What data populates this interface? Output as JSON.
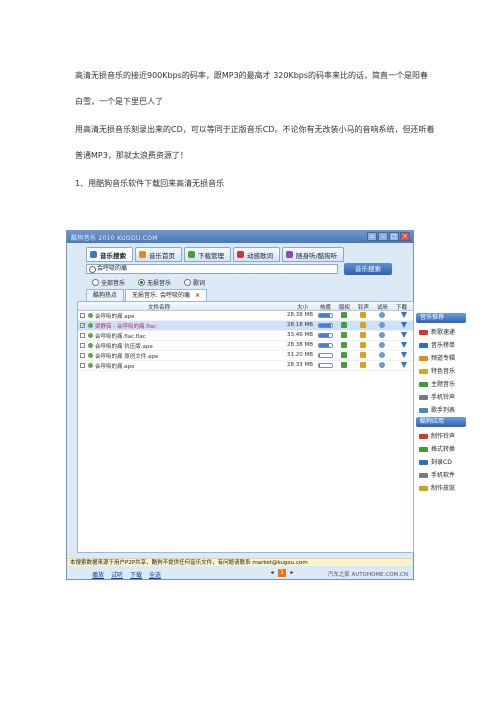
{
  "article": {
    "p1": "高清无损音乐的接近900Kbps的码率，跟MP3的最高才 320Kbps的码率来比的话，简直一个是阳春白雪，一个是下里巴人了",
    "p2": "用高清无损音乐刻录出来的CD，可以等同于正版音乐CD。不论你有无改装小马的音响系统，但还听着普通MP3，那就太浪费资源了！",
    "p3": "1、用酷狗音乐软件下载回来高清无损音乐"
  },
  "app": {
    "window_title": "酷狗音乐 2010 KUGOU.COM",
    "window_buttons": [
      "▫",
      "–",
      "□",
      "×"
    ],
    "tabs": [
      {
        "label": "音乐搜索",
        "icon": "search-icon",
        "color": "#3a77c9"
      },
      {
        "label": "音乐首页",
        "icon": "home-icon",
        "color": "#d98b22"
      },
      {
        "label": "下载管理",
        "icon": "download-icon",
        "color": "#4a9e3a"
      },
      {
        "label": "动感歌词",
        "icon": "lyrics-icon",
        "color": "#c7393a"
      },
      {
        "label": "随身听/酷狗听",
        "icon": "player-icon",
        "color": "#8a4bb5"
      }
    ],
    "search": {
      "value": "会呼吸的痛",
      "button": "音乐搜索"
    },
    "search_scope": [
      {
        "label": "全部音乐",
        "selected": false
      },
      {
        "label": "无损音乐",
        "selected": true
      },
      {
        "label": "歌词",
        "selected": false
      }
    ],
    "result_tabs": [
      {
        "label": "酷狗热点"
      },
      {
        "label": "无损音乐: 会呼吸的痛",
        "close": "×"
      }
    ],
    "table_headers": {
      "name": "文件名称",
      "size": "大小",
      "heat": "热度",
      "copyright": "版权",
      "ring": "铃声",
      "listen": "试听",
      "download": "下载"
    },
    "rows": [
      {
        "name": "会呼吸的痛.ape",
        "size": "28.38 MB",
        "heat": 0.85,
        "checked": false,
        "highlight": false
      },
      {
        "name": "梁静茹 - 会呼吸的痛.flac",
        "size": "28.18 MB",
        "heat": 0.9,
        "checked": true,
        "highlight": true
      },
      {
        "name": "会呼吸的痛.flac.flac",
        "size": "33.46 MB",
        "heat": 0.75,
        "checked": false,
        "highlight": false
      },
      {
        "name": "会呼吸的痛 抗压版.ape",
        "size": "28.38 MB",
        "heat": 0.8,
        "checked": false,
        "highlight": false
      },
      {
        "name": "会呼吸的痛 原创文件.ape",
        "size": "31.20 MB",
        "heat": 0.1,
        "checked": false,
        "highlight": false
      },
      {
        "name": "会呼吸的痛.ape",
        "size": "28.33 MB",
        "heat": 0.1,
        "checked": false,
        "highlight": false
      }
    ],
    "right_panel": {
      "section1": "音乐推荐",
      "items1": [
        {
          "label": "新歌速递",
          "color": "#d23a2a"
        },
        {
          "label": "音乐榜单",
          "color": "#2f6bc4"
        },
        {
          "label": "频道专辑",
          "color": "#e48a1d"
        },
        {
          "label": "特色音乐",
          "color": "#d6a81c"
        },
        {
          "label": "主题音乐",
          "color": "#3a9c3a"
        },
        {
          "label": "手机铃声",
          "color": "#7a7a7a"
        },
        {
          "label": "歌手列表",
          "color": "#4a86c9"
        }
      ],
      "section2": "酷狗应用",
      "items2": [
        {
          "label": "制作铃声",
          "color": "#d23a2a"
        },
        {
          "label": "格式转换",
          "color": "#3a9c3a"
        },
        {
          "label": "刻录CD",
          "color": "#2f6bc4"
        },
        {
          "label": "手机软件",
          "color": "#7a7a7a"
        },
        {
          "label": "制作皮肤",
          "color": "#c7a41c"
        }
      ]
    },
    "status": "本搜索数据来源于用户P2P共享，酷狗不提供任何音乐文件，有问题请联系 market@kugou.com",
    "bottom_links": [
      "播放",
      "试听",
      "下载",
      "全选"
    ],
    "pager": {
      "prev": "◂",
      "current": "1",
      "next": "▸"
    },
    "brand": "汽车之家 AUTOHOME.COM.CN"
  }
}
